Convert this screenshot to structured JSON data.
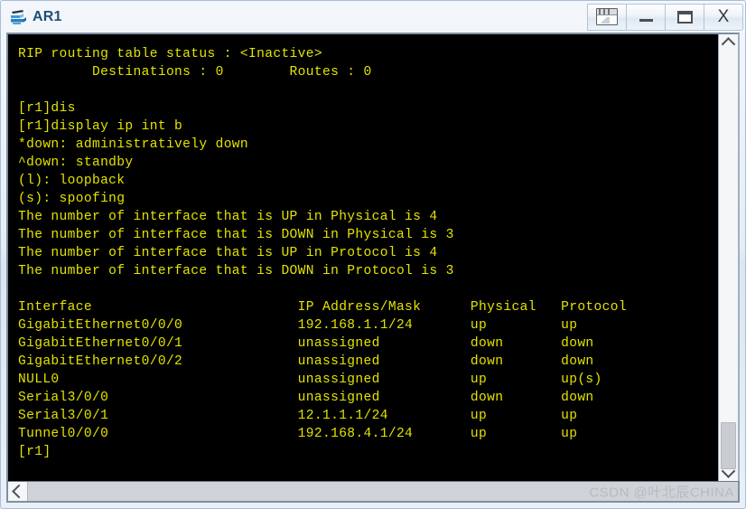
{
  "window": {
    "title": "AR1",
    "icon": "router-device-icon",
    "controls": [
      {
        "name": "snapshot-button",
        "label": "Snapshot"
      },
      {
        "name": "minimize-button",
        "label": "Minimize"
      },
      {
        "name": "maximize-button",
        "label": "Maximize"
      },
      {
        "name": "close-button",
        "label": "X"
      }
    ]
  },
  "terminal": {
    "lines": [
      "RIP routing table status : <Inactive>",
      "         Destinations : 0        Routes : 0",
      "",
      "[r1]dis",
      "[r1]display ip int b",
      "*down: administratively down",
      "^down: standby",
      "(l): loopback",
      "(s): spoofing",
      "The number of interface that is UP in Physical is 4",
      "The number of interface that is DOWN in Physical is 3",
      "The number of interface that is UP in Protocol is 4",
      "The number of interface that is DOWN in Protocol is 3",
      "",
      "Interface                         IP Address/Mask      Physical   Protocol",
      "GigabitEthernet0/0/0              192.168.1.1/24       up         up",
      "GigabitEthernet0/0/1              unassigned           down       down",
      "GigabitEthernet0/0/2              unassigned           down       down",
      "NULL0                             unassigned           up         up(s)",
      "Serial3/0/0                       unassigned           down       down",
      "Serial3/0/1                       12.1.1.1/24          up         up",
      "Tunnel0/0/0                       192.168.4.1/24       up         up",
      "[r1]"
    ],
    "rip_status": {
      "label": "RIP routing table status",
      "value": "<Inactive>",
      "destinations": "0",
      "routes": "0"
    },
    "commands": [
      "[r1]dis",
      "[r1]display ip int b"
    ],
    "legend": [
      "*down: administratively down",
      "^down: standby",
      "(l): loopback",
      "(s): spoofing"
    ],
    "counters": [
      {
        "text": "The number of interface that is UP in Physical is 4",
        "state": "UP",
        "layer": "Physical",
        "count": "4"
      },
      {
        "text": "The number of interface that is DOWN in Physical is 3",
        "state": "DOWN",
        "layer": "Physical",
        "count": "3"
      },
      {
        "text": "The number of interface that is UP in Protocol is 4",
        "state": "UP",
        "layer": "Protocol",
        "count": "4"
      },
      {
        "text": "The number of interface that is DOWN in Protocol is 3",
        "state": "DOWN",
        "layer": "Protocol",
        "count": "3"
      }
    ],
    "interface_table": {
      "headers": [
        "Interface",
        "IP Address/Mask",
        "Physical",
        "Protocol"
      ],
      "rows": [
        [
          "GigabitEthernet0/0/0",
          "192.168.1.1/24",
          "up",
          "up"
        ],
        [
          "GigabitEthernet0/0/1",
          "unassigned",
          "down",
          "down"
        ],
        [
          "GigabitEthernet0/0/2",
          "unassigned",
          "down",
          "down"
        ],
        [
          "NULL0",
          "unassigned",
          "up",
          "up(s)"
        ],
        [
          "Serial3/0/0",
          "unassigned",
          "down",
          "down"
        ],
        [
          "Serial3/0/1",
          "12.1.1.1/24",
          "up",
          "up"
        ],
        [
          "Tunnel0/0/0",
          "192.168.4.1/24",
          "up",
          "up"
        ]
      ]
    },
    "prompt": "[r1]",
    "colors": {
      "background": "#000000",
      "foreground": "#e3e300"
    }
  },
  "scrollbars": {
    "vertical": {
      "up_arrow": "chevron-up-icon",
      "down_arrow": "chevron-down-icon"
    },
    "horizontal": {
      "left_arrow": "chevron-left-icon"
    }
  },
  "watermark": "CSDN @叶北辰CHINA"
}
